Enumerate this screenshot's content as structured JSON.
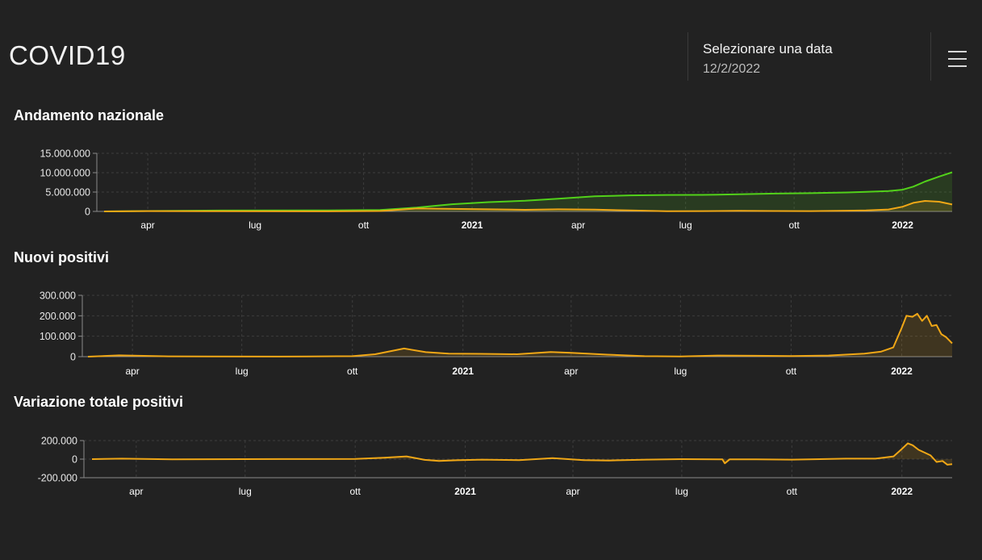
{
  "header": {
    "app_title": "COVID19",
    "date_label": "Selezionare una data",
    "date_value": "12/2/2022",
    "menu_icon": "hamburger-menu-icon"
  },
  "colors": {
    "background": "#222222",
    "green": "#52d11a",
    "orange": "#f0a716",
    "grid": "#3d3d3d",
    "axis": "#8a8a8a"
  },
  "chart_data": [
    {
      "type": "area",
      "title": "Andamento nazionale",
      "x_start": "2020-02-24",
      "x_end": "2022-02-12",
      "x_ticks": [
        {
          "date": "2020-04-01",
          "label": "apr",
          "bold": false
        },
        {
          "date": "2020-07-01",
          "label": "lug",
          "bold": false
        },
        {
          "date": "2020-10-01",
          "label": "ott",
          "bold": false
        },
        {
          "date": "2021-01-01",
          "label": "2021",
          "bold": true
        },
        {
          "date": "2021-04-01",
          "label": "apr",
          "bold": false
        },
        {
          "date": "2021-07-01",
          "label": "lug",
          "bold": false
        },
        {
          "date": "2021-10-01",
          "label": "ott",
          "bold": false
        },
        {
          "date": "2022-01-01",
          "label": "2022",
          "bold": true
        }
      ],
      "ylim": [
        0,
        15000000
      ],
      "y_ticks": [
        {
          "value": 0,
          "label": "0"
        },
        {
          "value": 5000000,
          "label": "5.000.000"
        },
        {
          "value": 10000000,
          "label": "10.000.000"
        },
        {
          "value": 15000000,
          "label": "15.000.000"
        }
      ],
      "grid": true,
      "series": [
        {
          "color": "#52d11a",
          "x": [
            "2020-02-24",
            "2020-04-01",
            "2020-06-01",
            "2020-09-01",
            "2020-10-15",
            "2020-11-15",
            "2020-12-15",
            "2021-01-15",
            "2021-02-15",
            "2021-03-15",
            "2021-04-15",
            "2021-05-15",
            "2021-06-15",
            "2021-07-15",
            "2021-08-15",
            "2021-09-15",
            "2021-10-15",
            "2021-11-15",
            "2021-12-01",
            "2021-12-20",
            "2022-01-01",
            "2022-01-10",
            "2022-01-20",
            "2022-02-01",
            "2022-02-12"
          ],
          "values": [
            0,
            110000,
            230000,
            280000,
            380000,
            1000000,
            1850000,
            2400000,
            2750000,
            3300000,
            3900000,
            4150000,
            4250000,
            4280000,
            4420000,
            4600000,
            4700000,
            4900000,
            5050000,
            5250000,
            5600000,
            6400000,
            7700000,
            9000000,
            10100000
          ]
        },
        {
          "color": "#f0a716",
          "x": [
            "2020-02-24",
            "2020-04-01",
            "2020-06-01",
            "2020-09-01",
            "2020-10-15",
            "2020-11-15",
            "2020-12-15",
            "2021-01-15",
            "2021-02-15",
            "2021-03-15",
            "2021-04-15",
            "2021-05-15",
            "2021-06-15",
            "2021-07-15",
            "2021-08-15",
            "2021-09-15",
            "2021-10-15",
            "2021-11-15",
            "2021-12-01",
            "2021-12-20",
            "2022-01-01",
            "2022-01-10",
            "2022-01-20",
            "2022-02-01",
            "2022-02-12"
          ],
          "values": [
            0,
            80000,
            40000,
            30000,
            100000,
            750000,
            650000,
            550000,
            420000,
            550000,
            480000,
            250000,
            70000,
            80000,
            140000,
            100000,
            90000,
            180000,
            250000,
            500000,
            1200000,
            2200000,
            2700000,
            2500000,
            1800000
          ]
        }
      ]
    },
    {
      "type": "area",
      "title": "Nuovi positivi",
      "x_start": "2020-02-24",
      "x_end": "2022-02-12",
      "x_ticks": [
        {
          "date": "2020-04-01",
          "label": "apr",
          "bold": false
        },
        {
          "date": "2020-07-01",
          "label": "lug",
          "bold": false
        },
        {
          "date": "2020-10-01",
          "label": "ott",
          "bold": false
        },
        {
          "date": "2021-01-01",
          "label": "2021",
          "bold": true
        },
        {
          "date": "2021-04-01",
          "label": "apr",
          "bold": false
        },
        {
          "date": "2021-07-01",
          "label": "lug",
          "bold": false
        },
        {
          "date": "2021-10-01",
          "label": "ott",
          "bold": false
        },
        {
          "date": "2022-01-01",
          "label": "2022",
          "bold": true
        }
      ],
      "ylim": [
        0,
        300000
      ],
      "y_ticks": [
        {
          "value": 0,
          "label": "0"
        },
        {
          "value": 100000,
          "label": "100.000"
        },
        {
          "value": 200000,
          "label": "200.000"
        },
        {
          "value": 300000,
          "label": "300.000"
        }
      ],
      "grid": true,
      "series": [
        {
          "color": "#f0a716",
          "x": [
            "2020-02-24",
            "2020-03-21",
            "2020-05-01",
            "2020-08-01",
            "2020-10-01",
            "2020-10-20",
            "2020-11-13",
            "2020-12-01",
            "2020-12-20",
            "2021-01-15",
            "2021-02-15",
            "2021-03-15",
            "2021-04-01",
            "2021-05-01",
            "2021-06-01",
            "2021-07-01",
            "2021-08-01",
            "2021-09-01",
            "2021-10-01",
            "2021-11-01",
            "2021-12-01",
            "2021-12-15",
            "2021-12-25",
            "2022-01-01",
            "2022-01-05",
            "2022-01-10",
            "2022-01-14",
            "2022-01-18",
            "2022-01-22",
            "2022-01-26",
            "2022-01-30",
            "2022-02-03",
            "2022-02-07",
            "2022-02-12"
          ],
          "values": [
            0,
            6500,
            1500,
            400,
            2500,
            12000,
            40000,
            22000,
            15000,
            14000,
            12000,
            23000,
            19000,
            10000,
            2500,
            1000,
            5500,
            4500,
            2800,
            5500,
            15000,
            25000,
            45000,
            140000,
            200000,
            195000,
            210000,
            175000,
            200000,
            150000,
            155000,
            110000,
            95000,
            65000
          ]
        }
      ]
    },
    {
      "type": "area",
      "title": "Variazione totale positivi",
      "x_start": "2020-02-24",
      "x_end": "2022-02-12",
      "x_ticks": [
        {
          "date": "2020-04-01",
          "label": "apr",
          "bold": false
        },
        {
          "date": "2020-07-01",
          "label": "lug",
          "bold": false
        },
        {
          "date": "2020-10-01",
          "label": "ott",
          "bold": false
        },
        {
          "date": "2021-01-01",
          "label": "2021",
          "bold": true
        },
        {
          "date": "2021-04-01",
          "label": "apr",
          "bold": false
        },
        {
          "date": "2021-07-01",
          "label": "lug",
          "bold": false
        },
        {
          "date": "2021-10-01",
          "label": "ott",
          "bold": false
        },
        {
          "date": "2022-01-01",
          "label": "2022",
          "bold": true
        }
      ],
      "ylim": [
        -200000,
        200000
      ],
      "y_ticks": [
        {
          "value": -200000,
          "label": "-200.000"
        },
        {
          "value": 0,
          "label": "0"
        },
        {
          "value": 200000,
          "label": "200.000"
        }
      ],
      "grid": true,
      "series": [
        {
          "color": "#f0a716",
          "x": [
            "2020-02-24",
            "2020-03-20",
            "2020-05-01",
            "2020-08-01",
            "2020-10-01",
            "2020-10-25",
            "2020-11-13",
            "2020-11-28",
            "2020-12-10",
            "2020-12-25",
            "2021-01-15",
            "2021-02-15",
            "2021-03-15",
            "2021-04-10",
            "2021-05-01",
            "2021-06-01",
            "2021-07-01",
            "2021-08-04",
            "2021-08-06",
            "2021-08-10",
            "2021-09-01",
            "2021-10-01",
            "2021-11-15",
            "2021-12-10",
            "2021-12-25",
            "2022-01-01",
            "2022-01-06",
            "2022-01-10",
            "2022-01-15",
            "2022-01-20",
            "2022-01-25",
            "2022-01-30",
            "2022-02-04",
            "2022-02-08",
            "2022-02-12"
          ],
          "values": [
            0,
            5000,
            -2000,
            500,
            1500,
            15000,
            30000,
            -8000,
            -20000,
            -12000,
            -5000,
            -10000,
            10000,
            -10000,
            -15000,
            -5000,
            0,
            -3000,
            -45000,
            -3000,
            -3000,
            -5000,
            5000,
            5000,
            30000,
            110000,
            170000,
            150000,
            100000,
            70000,
            40000,
            -30000,
            -20000,
            -60000,
            -55000
          ]
        }
      ]
    }
  ]
}
